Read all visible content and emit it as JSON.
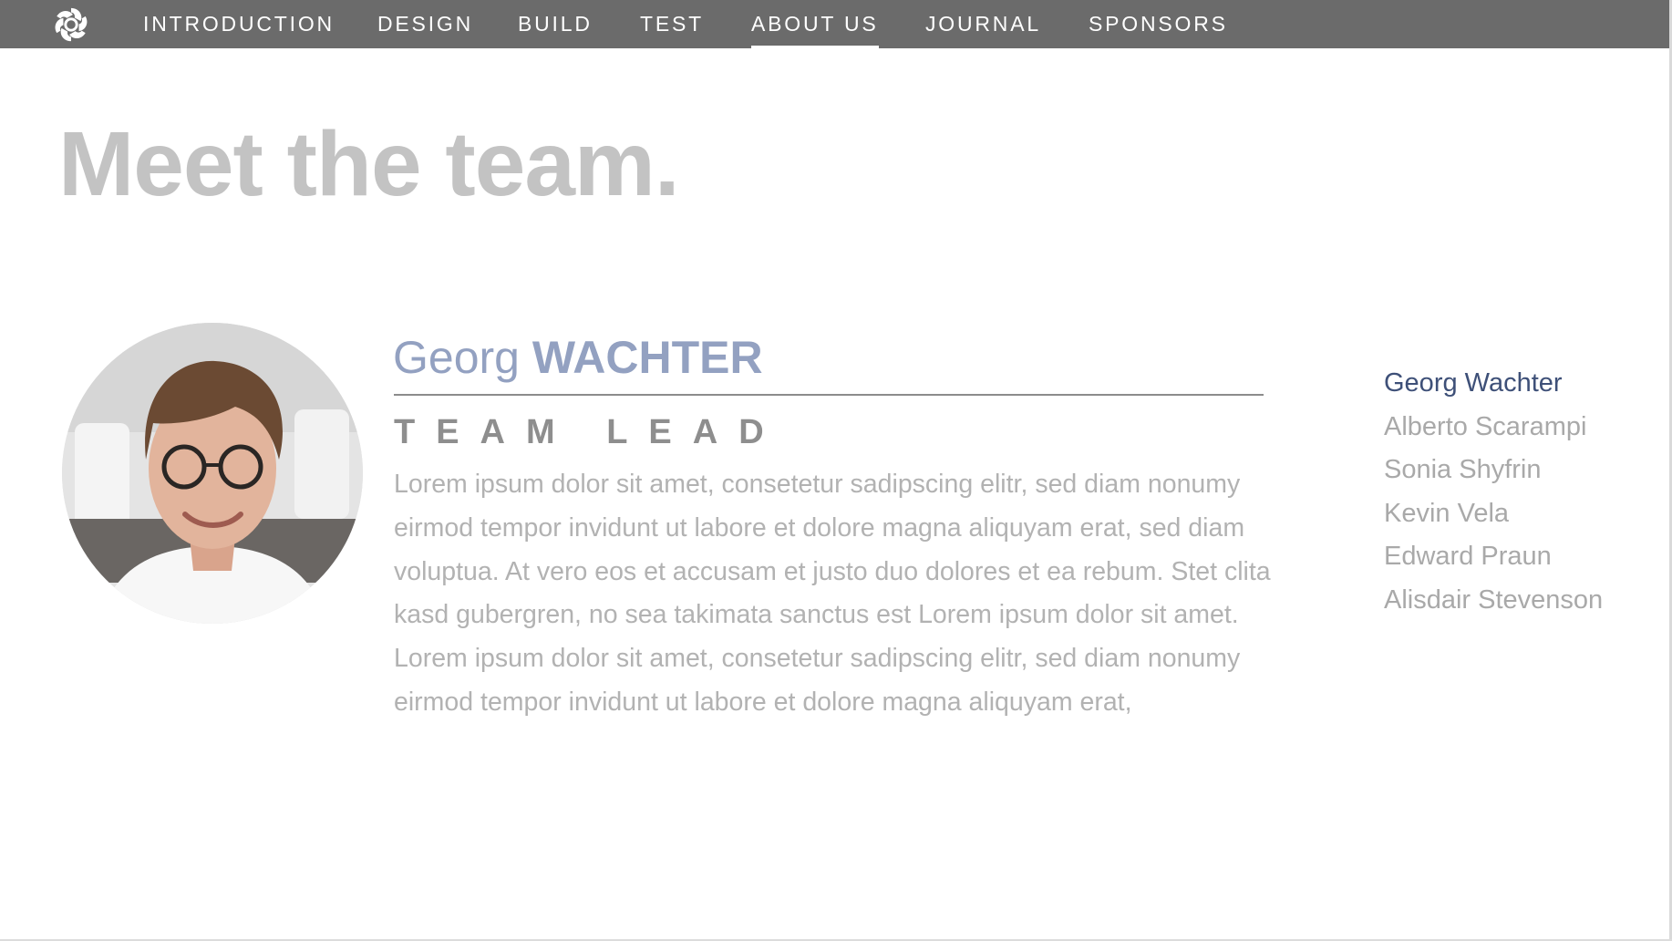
{
  "nav": {
    "items": [
      {
        "label": "INTRODUCTION",
        "active": false
      },
      {
        "label": "DESIGN",
        "active": false
      },
      {
        "label": "BUILD",
        "active": false
      },
      {
        "label": "TEST",
        "active": false
      },
      {
        "label": "ABOUT US",
        "active": true
      },
      {
        "label": "JOURNAL",
        "active": false
      },
      {
        "label": "SPONSORS",
        "active": false
      }
    ],
    "logo_icon": "flower-logo-icon",
    "background_color": "#6b6b6b"
  },
  "main": {
    "heading": "Meet the team.",
    "profile": {
      "first_name": "Georg",
      "last_name": "WACHTER",
      "role": "TEAM LEAD",
      "bio": "Lorem ipsum dolor sit amet, consetetur sadipscing elitr, sed diam nonumy eirmod tempor invidunt ut labore et dolore magna aliquyam erat, sed diam voluptua. At vero eos et accusam et justo duo dolores et ea rebum. Stet clita kasd gubergren, no sea takimata sanctus est Lorem ipsum dolor sit amet. Lorem ipsum dolor sit amet, consetetur sadipscing elitr, sed diam nonumy eirmod tempor invidunt ut labore et dolore magna aliquyam erat,",
      "photo_icon": "profile-photo"
    },
    "team_list": [
      {
        "name": "Georg Wachter",
        "active": true
      },
      {
        "name": "Alberto Scarampi",
        "active": false
      },
      {
        "name": "Sonia Shyfrin",
        "active": false
      },
      {
        "name": "Kevin Vela",
        "active": false
      },
      {
        "name": "Edward Praun",
        "active": false
      },
      {
        "name": "Alisdair Stevenson",
        "active": false
      }
    ]
  },
  "colors": {
    "heading": "#c3c3c3",
    "name": "#93a1c1",
    "active_member": "#3e5078",
    "inactive_member": "#a9a9a9",
    "bio_text": "#b2b2b2"
  }
}
